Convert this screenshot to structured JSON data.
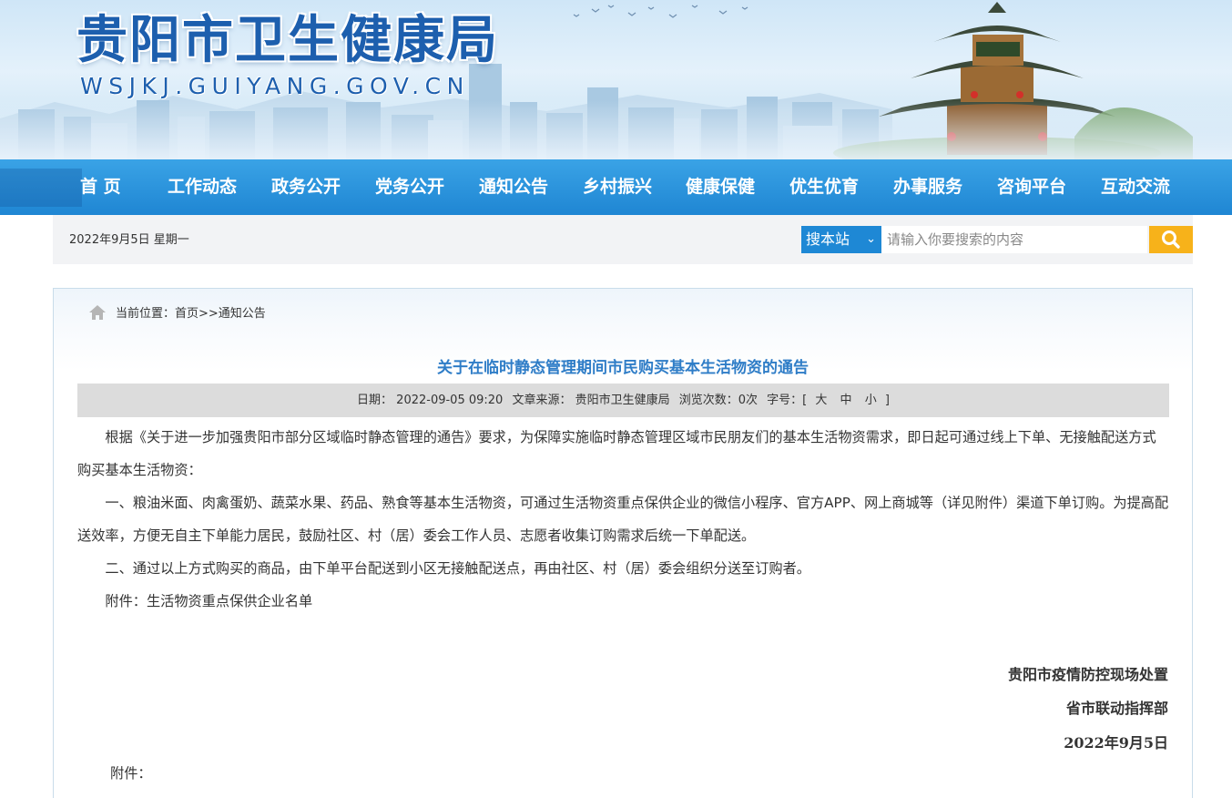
{
  "header": {
    "title": "贵阳市卫生健康局",
    "domain": "WSJKJ.GUIYANG.GOV.CN"
  },
  "nav": {
    "items": [
      {
        "label": "首 页"
      },
      {
        "label": "工作动态"
      },
      {
        "label": "政务公开"
      },
      {
        "label": "党务公开"
      },
      {
        "label": "通知公告"
      },
      {
        "label": "乡村振兴"
      },
      {
        "label": "健康保健"
      },
      {
        "label": "优生优育"
      },
      {
        "label": "办事服务"
      },
      {
        "label": "咨询平台"
      },
      {
        "label": "互动交流"
      }
    ]
  },
  "infobar": {
    "date": "2022年9月5日  星期一",
    "search_scope": "搜本站",
    "search_placeholder": "请输入你要搜索的内容",
    "search_icon": "search-icon",
    "accent": "#1e88d5",
    "search_button_color": "#f7b21a"
  },
  "breadcrumb": {
    "text": "当前位置：首页>>通知公告",
    "icon": "home-icon"
  },
  "article": {
    "title": "关于在临时静态管理期间市民购买基本生活物资的通告",
    "meta": {
      "date": "日期： 2022-09-05 09:20",
      "source": "文章来源： 贵阳市卫生健康局",
      "views": "浏览次数：0次",
      "font_label": "字号：[",
      "font_large": "大",
      "font_medium": "中",
      "font_small": "小",
      "font_close": "]"
    },
    "paragraphs": [
      "根据《关于进一步加强贵阳市部分区域临时静态管理的通告》要求，为保障实施临时静态管理区域市民朋友们的基本生活物资需求，即日起可通过线上下单、无接触配送方式购买基本生活物资：",
      "一、粮油米面、肉禽蛋奶、蔬菜水果、药品、熟食等基本生活物资，可通过生活物资重点保供企业的微信小程序、官方APP、网上商城等（详见附件）渠道下单订购。为提高配送效率，方便无自主下单能力居民，鼓励社区、村（居）委会工作人员、志愿者收集订购需求后统一下单配送。",
      "二、通过以上方式购买的商品，由下单平台配送到小区无接触配送点，再由社区、村（居）委会组织分送至订购者。",
      "附件：生活物资重点保供企业名单"
    ],
    "signature": {
      "org1": "贵阳市疫情防控现场处置",
      "org2": "省市联动指挥部",
      "date": "2022年9月5日"
    },
    "attachment_label": "附件："
  },
  "colors": {
    "title_blue": "#1d5fae",
    "nav_blue": "#2a93dc",
    "article_title": "#2f7dc7"
  }
}
